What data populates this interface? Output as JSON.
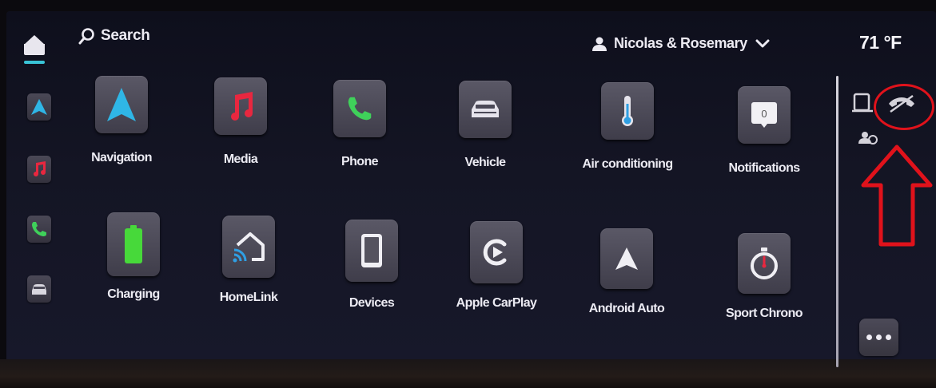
{
  "top_bar": {
    "search_label": "Search",
    "profile_name": "Nicolas & Rosemary",
    "temperature": "71 °F"
  },
  "dock": {
    "items": [
      "home-icon",
      "navigation-icon",
      "music-icon",
      "phone-icon",
      "car-icon"
    ]
  },
  "apps": [
    {
      "label": "Navigation",
      "icon": "navigation-arrow-icon"
    },
    {
      "label": "Media",
      "icon": "music-note-icon"
    },
    {
      "label": "Phone",
      "icon": "phone-icon"
    },
    {
      "label": "Vehicle",
      "icon": "car-icon"
    },
    {
      "label": "Air conditioning",
      "icon": "thermometer-icon"
    },
    {
      "label": "Notifications",
      "icon": "notification-bubble-icon"
    },
    {
      "label": "Charging",
      "icon": "battery-icon"
    },
    {
      "label": "HomeLink",
      "icon": "homelink-icon"
    },
    {
      "label": "Devices",
      "icon": "tablet-icon"
    },
    {
      "label": "Apple CarPlay",
      "icon": "carplay-icon"
    },
    {
      "label": "Android Auto",
      "icon": "android-auto-icon"
    },
    {
      "label": "Sport Chrono",
      "icon": "stopwatch-icon"
    }
  ],
  "notifications_count": "0",
  "status_icons": [
    "tablet-status-icon",
    "phone-muted-icon",
    "account-icon"
  ],
  "annotation": {
    "color": "#e0121b",
    "shapes": [
      "circle",
      "up-arrow"
    ]
  },
  "colors": {
    "accent_cyan": "#39c3d6",
    "media_red": "#e8273f",
    "phone_green": "#3fd15a",
    "charging_green": "#47d93a"
  }
}
